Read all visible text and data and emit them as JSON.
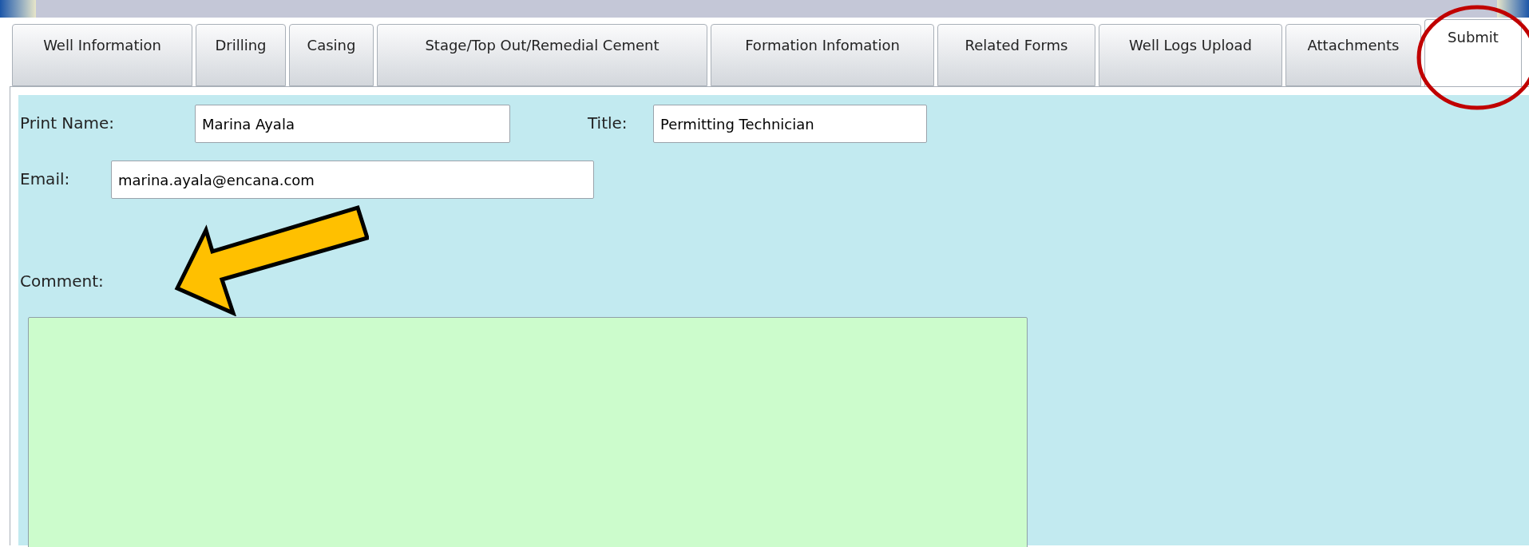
{
  "tabs": [
    {
      "label": "Well Information",
      "selected": false
    },
    {
      "label": "Drilling",
      "selected": false
    },
    {
      "label": "Casing",
      "selected": false
    },
    {
      "label": "Stage/Top Out/Remedial Cement",
      "selected": false
    },
    {
      "label": "Formation Infomation",
      "selected": false
    },
    {
      "label": "Related Forms",
      "selected": false
    },
    {
      "label": "Well Logs Upload",
      "selected": false
    },
    {
      "label": "Attachments",
      "selected": false
    },
    {
      "label": "Submit",
      "selected": true
    }
  ],
  "form": {
    "print_name": {
      "label": "Print Name:",
      "value": "Marina Ayala"
    },
    "title": {
      "label": "Title:",
      "value": "Permitting Technician"
    },
    "email": {
      "label": "Email:",
      "value": "marina.ayala@encana.com"
    },
    "comment": {
      "label": "Comment:"
    }
  }
}
